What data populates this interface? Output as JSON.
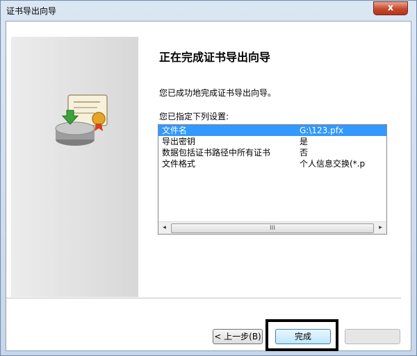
{
  "window": {
    "title": "证书导出向导",
    "close_label": "x"
  },
  "wizard": {
    "heading": "正在完成证书导出向导",
    "message": "您已成功地完成证书导出向导。",
    "settings_label": "您已指定下列设置:",
    "settings": [
      {
        "name": "文件名",
        "value": "G:\\123.pfx"
      },
      {
        "name": "导出密钥",
        "value": "是"
      },
      {
        "name": "数据包括证书路径中所有证书",
        "value": "否"
      },
      {
        "name": "文件格式",
        "value": "个人信息交换(*.p"
      }
    ],
    "scroll_thumb_label": "III"
  },
  "buttons": {
    "back": "< 上一步(B)",
    "finish": "完成"
  },
  "icons": {
    "scroll_left": "◂",
    "scroll_right": "▸"
  }
}
